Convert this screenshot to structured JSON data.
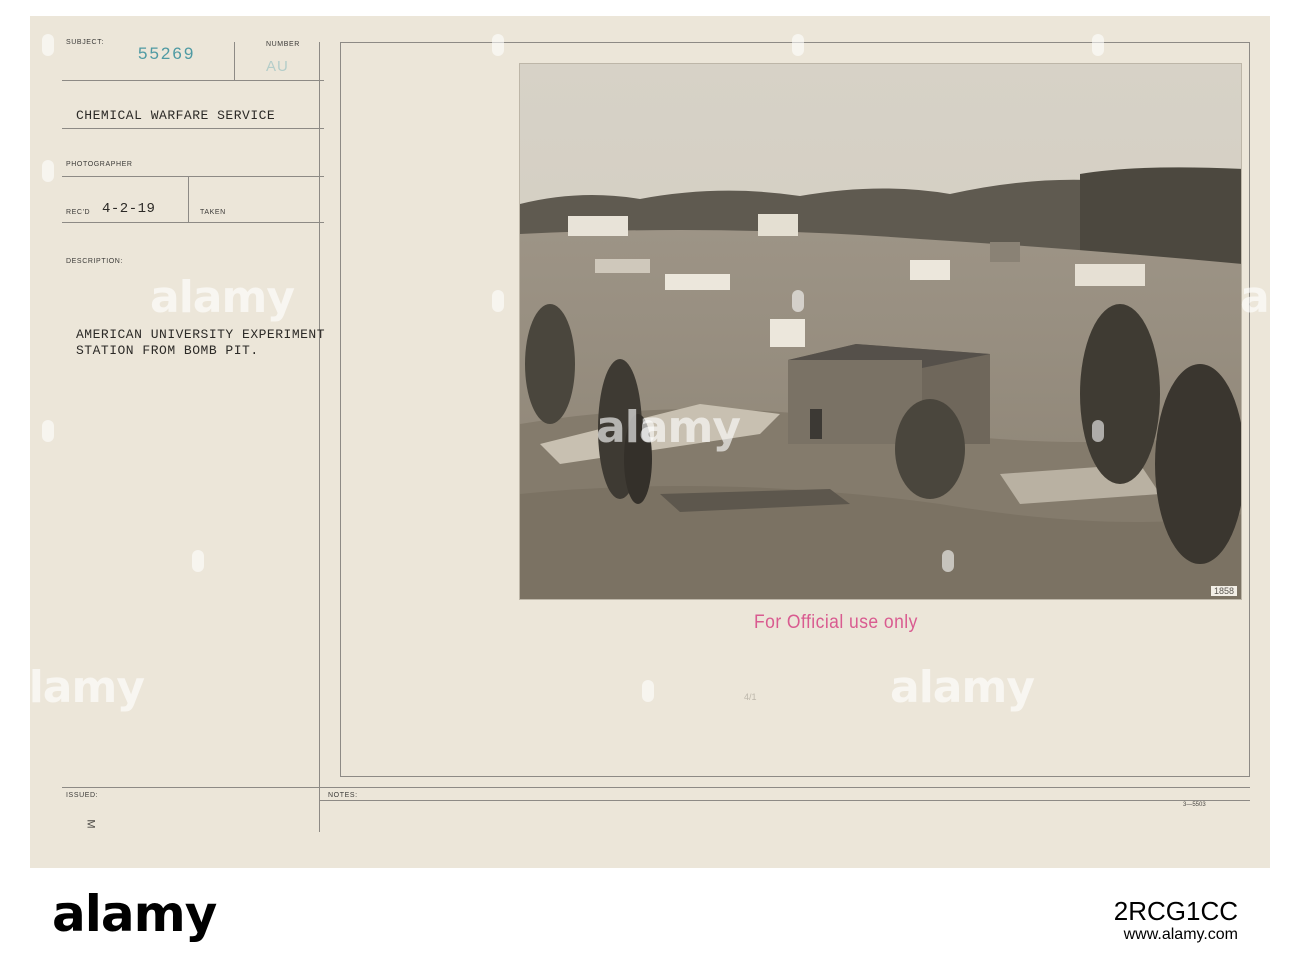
{
  "card": {
    "subject_label": "SUBJECT:",
    "subject_number": "55269",
    "number_label": "NUMBER",
    "number_value": "AU",
    "organization": "CHEMICAL WARFARE SERVICE",
    "photographer_label": "PHOTOGRAPHER",
    "recd_label": "REC'D",
    "recd_date": "4-2-19",
    "taken_label": "TAKEN",
    "description_label": "DESCRIPTION:",
    "description_line1": "AMERICAN UNIVERSITY EXPERIMENT",
    "description_line2": "STATION FROM BOMB PIT.",
    "issued_label": "ISSUED:",
    "notes_label": "NOTES:",
    "issued_mark": "M",
    "form_code": "3—5503",
    "photo_number": "1858",
    "official_stamp": "For Official use only",
    "pencil_mark": "4/1"
  },
  "watermark": {
    "text": "alamy"
  },
  "banner": {
    "logo": "alamy",
    "image_id": "2RCG1CC",
    "url": "www.alamy.com"
  },
  "colors": {
    "card": "#ece6d9",
    "stamp_number": "#4f9aa3",
    "official_stamp": "#d95b90",
    "rule_lines": "#8d8a85"
  }
}
